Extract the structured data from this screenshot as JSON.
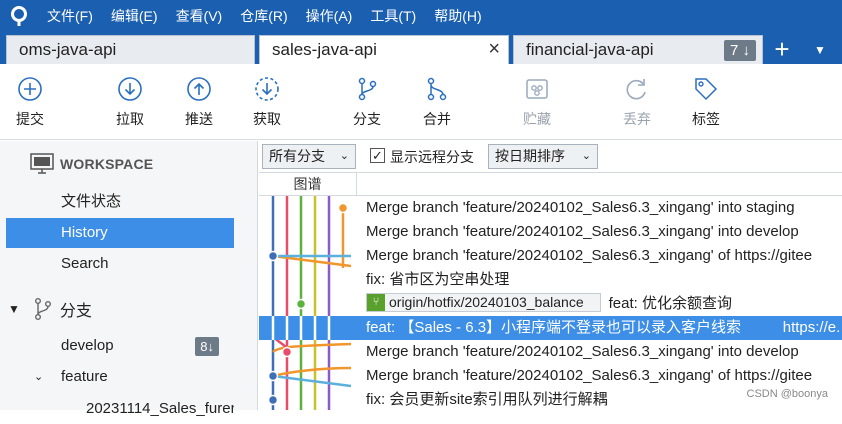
{
  "menu": [
    "文件(F)",
    "编辑(E)",
    "查看(V)",
    "仓库(R)",
    "操作(A)",
    "工具(T)",
    "帮助(H)"
  ],
  "tabs": [
    {
      "label": "oms-java-api"
    },
    {
      "label": "sales-java-api",
      "close": "×"
    },
    {
      "label": "financial-java-api",
      "count": "7 ↓"
    }
  ],
  "tab_add": "+",
  "tab_menu": "▼",
  "toolbar": [
    "提交",
    "拉取",
    "推送",
    "获取",
    "分支",
    "合并",
    "贮藏",
    "丢弃",
    "标签"
  ],
  "sidebar": {
    "workspace": "WORKSPACE",
    "items": [
      "文件状态",
      "History",
      "Search"
    ],
    "branches_label": "分支",
    "branches": [
      {
        "name": "develop",
        "badge": "8↓"
      },
      {
        "name": "feature"
      },
      {
        "name": "20231114_Sales_furen"
      }
    ]
  },
  "filter": {
    "branches": "所有分支",
    "show_remote": "显示远程分支",
    "sort": "按日期排序"
  },
  "graph_header": "图谱",
  "commits": [
    "Merge branch 'feature/20240102_Sales6.3_xingang' into staging",
    "Merge branch 'feature/20240102_Sales6.3_xingang' into develop",
    "Merge branch 'feature/20240102_Sales6.3_xingang' of https://gitee",
    "fix: 省市区为空串处理",
    "feat: 优化余额查询",
    "feat: 【Sales - 6.3】小程序端不登录也可以录入客户线索          https://e.",
    "Merge branch 'feature/20240102_Sales6.3_xingang' into develop",
    "Merge branch 'feature/20240102_Sales6.3_xingang' of https://gitee",
    "fix: 会员更新site索引用队列进行解耦"
  ],
  "ref_tag": "origin/hotfix/20240103_balance",
  "watermark": "CSDN @boonya",
  "colors": {
    "accent": "#1b5fb0",
    "selection": "#3d8ee6"
  }
}
